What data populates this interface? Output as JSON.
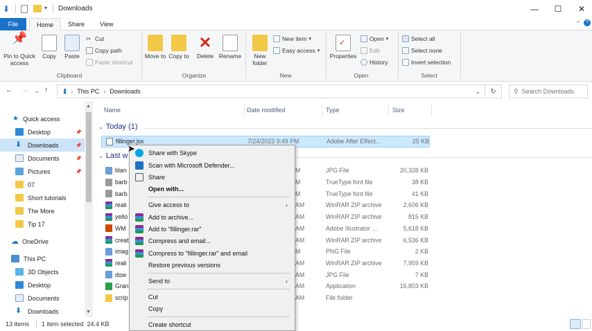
{
  "window": {
    "title": "Downloads",
    "controls": {
      "minimize": "—",
      "maximize": "☐",
      "close": "✕"
    }
  },
  "ribbon_tabs": [
    "File",
    "Home",
    "Share",
    "View"
  ],
  "ribbon": {
    "clipboard": {
      "pin": "Pin to Quick access",
      "copy": "Copy",
      "paste": "Paste",
      "cut": "Cut",
      "copy_path": "Copy path",
      "paste_shortcut": "Paste shortcut",
      "label": "Clipboard"
    },
    "organize": {
      "move_to": "Move to",
      "copy_to": "Copy to",
      "delete": "Delete",
      "rename": "Rename",
      "label": "Organize"
    },
    "new": {
      "new_folder": "New folder",
      "new_item": "New item",
      "easy_access": "Easy access",
      "label": "New"
    },
    "open": {
      "properties": "Properties",
      "open": "Open",
      "edit": "Edit",
      "history": "History",
      "label": "Open"
    },
    "select": {
      "select_all": "Select all",
      "select_none": "Select none",
      "invert": "Invert selection",
      "label": "Select"
    }
  },
  "address": {
    "crumbs": [
      "This PC",
      "Downloads"
    ],
    "search_placeholder": "Search Downloads"
  },
  "nav": {
    "quick_access": "Quick access",
    "items": [
      {
        "label": "Desktop",
        "pinned": true
      },
      {
        "label": "Downloads",
        "pinned": true
      },
      {
        "label": "Documents",
        "pinned": true
      },
      {
        "label": "Pictures",
        "pinned": true
      },
      {
        "label": "07",
        "pinned": false
      },
      {
        "label": "Short tutorials",
        "pinned": false
      },
      {
        "label": "The More",
        "pinned": false
      },
      {
        "label": "Tip 17",
        "pinned": false
      }
    ],
    "onedrive": "OneDrive",
    "this_pc": "This PC",
    "pc_items": [
      "3D Objects",
      "Desktop",
      "Documents",
      "Downloads"
    ]
  },
  "columns": {
    "name": "Name",
    "date": "Date modified",
    "type": "Type",
    "size": "Size"
  },
  "groups": {
    "today": "Today (1)",
    "last": "Last w"
  },
  "selected_file": {
    "name": "fillinger.jsx",
    "date": "7/24/2023 9:49 PM",
    "type": "Adobe After Effect...",
    "size": "25 KB"
  },
  "files": [
    {
      "name": "blan",
      "date_suffix": "M",
      "type": "JPG File",
      "size": "20,328 KB",
      "color": "#6a9ed8"
    },
    {
      "name": "barb",
      "date_suffix": "M",
      "type": "TrueType font file",
      "size": "38 KB",
      "color": "#9a9a9a"
    },
    {
      "name": "barb",
      "date_suffix": "M",
      "type": "TrueType font file",
      "size": "41 KB",
      "color": "#9a9a9a"
    },
    {
      "name": "reali",
      "date_suffix": "AM",
      "type": "WinRAR ZIP archive",
      "size": "2,606 KB",
      "color": "rar"
    },
    {
      "name": "yello",
      "date_suffix": "AM",
      "type": "WinRAR ZIP archive",
      "size": "815 KB",
      "color": "rar"
    },
    {
      "name": "WM",
      "date_suffix": "AM",
      "type": "Adobe Illustrator ...",
      "size": "5,618 KB",
      "color": "#cc4a00"
    },
    {
      "name": "creat",
      "date_suffix": "AM",
      "type": "WinRAR ZIP archive",
      "size": "6,536 KB",
      "color": "rar"
    },
    {
      "name": "imag",
      "date_suffix": "M",
      "type": "PNG File",
      "size": "2 KB",
      "color": "#6a9ed8"
    },
    {
      "name": "reali",
      "date_suffix": "AM",
      "type": "WinRAR ZIP archive",
      "size": "7,959 KB",
      "color": "rar"
    },
    {
      "name": "dow",
      "date_suffix": "AM",
      "type": "JPG File",
      "size": "7 KB",
      "color": "#6a9ed8"
    },
    {
      "name": "Gran",
      "date_suffix": "AM",
      "type": "Application",
      "size": "16,803 KB",
      "color": "#2e9e4f"
    },
    {
      "name": "scrip",
      "date_suffix": "AM",
      "type": "File folder",
      "size": "",
      "color": "#f3c847"
    }
  ],
  "context_menu": {
    "share_skype": "Share with Skype",
    "scan_defender": "Scan with Microsoft Defender...",
    "share": "Share",
    "open_with": "Open with...",
    "give_access": "Give access to",
    "add_archive": "Add to archive...",
    "add_rar": "Add to \"fillinger.rar\"",
    "compress_email": "Compress and email...",
    "compress_rar_email": "Compress to \"fillinger.rar\" and email",
    "restore": "Restore previous versions",
    "send_to": "Send to",
    "cut": "Cut",
    "copy": "Copy",
    "create_shortcut": "Create shortcut"
  },
  "status": {
    "count": "13 items",
    "selection": "1 item selected  24.4 KB"
  },
  "colors": {
    "accent": "#1a73c8",
    "selection": "#cce8ff",
    "folder": "#f3c847"
  }
}
